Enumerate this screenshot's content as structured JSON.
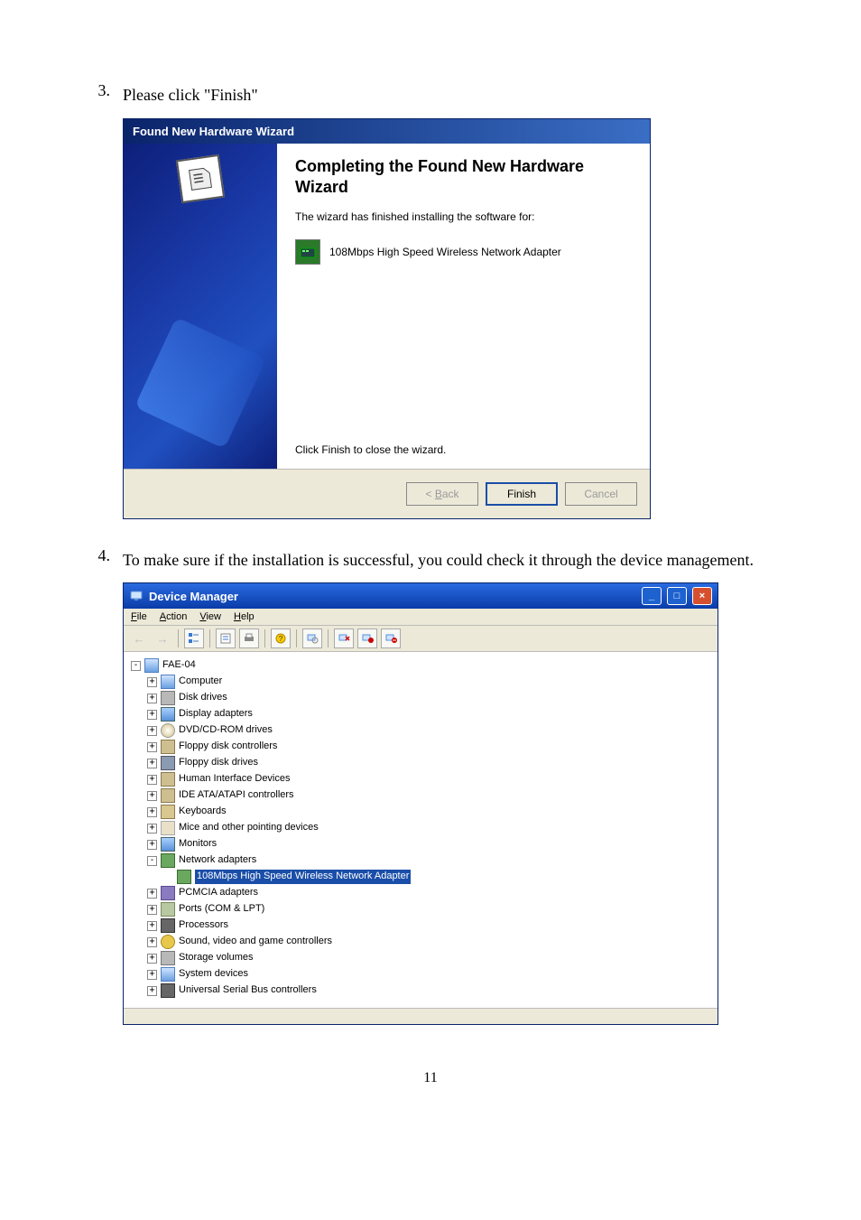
{
  "step3": {
    "num": "3.",
    "text": "Please click \"Finish\""
  },
  "step4": {
    "num": "4.",
    "text": "To make sure if the installation is successful, you could check it through the device management."
  },
  "wizard": {
    "title": "Found New Hardware Wizard",
    "heading": "Completing the Found New Hardware Wizard",
    "sub": "The wizard has finished installing the software for:",
    "device": "108Mbps High Speed Wireless Network Adapter",
    "foot": "Click Finish to close the wizard.",
    "buttons": {
      "back_pre": "< ",
      "back_u": "B",
      "back_post": "ack",
      "finish": "Finish",
      "cancel": "Cancel"
    }
  },
  "dm": {
    "title": "Device Manager",
    "menu": {
      "file_u": "F",
      "file": "ile",
      "action_u": "A",
      "action": "ction",
      "view_u": "V",
      "view": "iew",
      "help_u": "H",
      "help": "elp"
    },
    "root": "FAE-04",
    "items": [
      {
        "label": "Computer",
        "icon": "ic-comp",
        "exp": "+"
      },
      {
        "label": "Disk drives",
        "icon": "ic-disk",
        "exp": "+"
      },
      {
        "label": "Display adapters",
        "icon": "ic-disp",
        "exp": "+"
      },
      {
        "label": "DVD/CD-ROM drives",
        "icon": "ic-dvd",
        "exp": "+"
      },
      {
        "label": "Floppy disk controllers",
        "icon": "ic-floppy",
        "exp": "+"
      },
      {
        "label": "Floppy disk drives",
        "icon": "ic-floppyd",
        "exp": "+"
      },
      {
        "label": "Human Interface Devices",
        "icon": "ic-hid",
        "exp": "+"
      },
      {
        "label": "IDE ATA/ATAPI controllers",
        "icon": "ic-ide",
        "exp": "+"
      },
      {
        "label": "Keyboards",
        "icon": "ic-kb",
        "exp": "+"
      },
      {
        "label": "Mice and other pointing devices",
        "icon": "ic-mouse",
        "exp": "+"
      },
      {
        "label": "Monitors",
        "icon": "ic-mon",
        "exp": "+"
      },
      {
        "label": "Network adapters",
        "icon": "ic-net",
        "exp": "-",
        "child": {
          "label": "108Mbps High Speed Wireless Network Adapter",
          "icon": "ic-net",
          "sel": true
        }
      },
      {
        "label": "PCMCIA adapters",
        "icon": "ic-pcm",
        "exp": "+"
      },
      {
        "label": "Ports (COM & LPT)",
        "icon": "ic-port",
        "exp": "+"
      },
      {
        "label": "Processors",
        "icon": "ic-proc",
        "exp": "+"
      },
      {
        "label": "Sound, video and game controllers",
        "icon": "ic-sound",
        "exp": "+"
      },
      {
        "label": "Storage volumes",
        "icon": "ic-stor",
        "exp": "+"
      },
      {
        "label": "System devices",
        "icon": "ic-sys",
        "exp": "+"
      },
      {
        "label": "Universal Serial Bus controllers",
        "icon": "ic-usb",
        "exp": "+"
      }
    ]
  },
  "pagenum": "11"
}
